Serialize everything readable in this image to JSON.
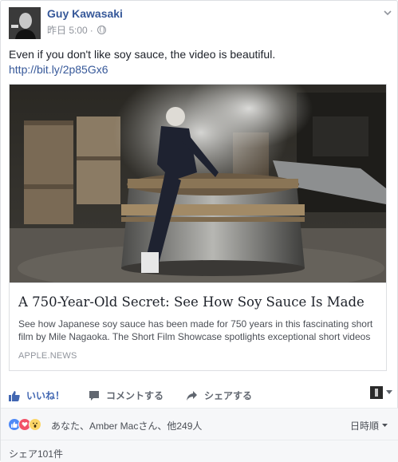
{
  "post": {
    "author": "Guy Kawasaki",
    "timestamp": "昨日 5:00",
    "privacy_sep": "·",
    "text": "Even if you don't like soy sauce, the video is beautiful.",
    "link": "http://bit.ly/2p85Gx6"
  },
  "preview": {
    "title": "A 750-Year-Old Secret: See How Soy Sauce Is Made",
    "description": "See how Japanese soy sauce has been made for 750 years in this fascinating short film by Mile Nagaoka. The Short Film Showcase spotlights exceptional short videos created by filmmakers from around the web and selected by National Geographic...",
    "domain": "APPLE.NEWS"
  },
  "actions": {
    "like": "いいね！",
    "comment": "コメントする",
    "share": "シェアする"
  },
  "reactions": {
    "summary": "あなた、Amber Macさん、他249人",
    "sort_label": "日時順"
  },
  "shares": {
    "count_label": "シェア101件"
  },
  "colors": {
    "link_blue": "#365899",
    "like_blue": "#4267b2",
    "meta_gray": "#90949c"
  }
}
